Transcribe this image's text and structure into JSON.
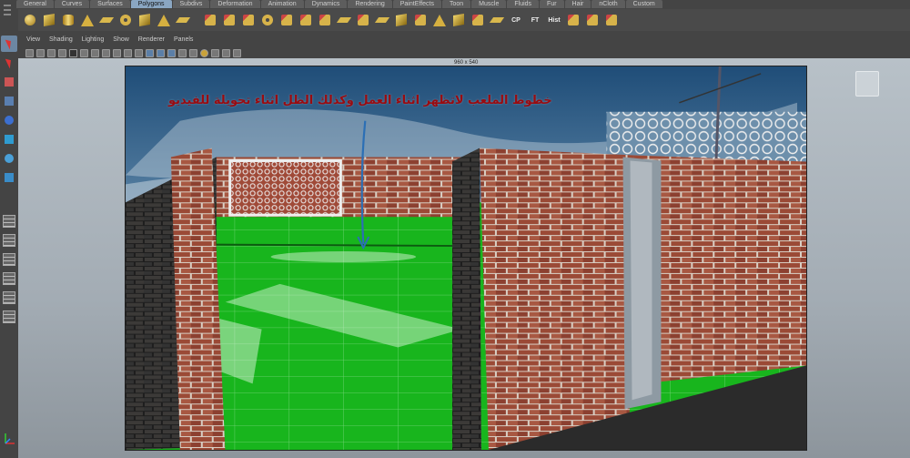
{
  "shelf": {
    "tabs": [
      "General",
      "Curves",
      "Surfaces",
      "Polygons",
      "Subdivs",
      "Deformation",
      "Animation",
      "Dynamics",
      "Rendering",
      "PaintEffects",
      "Toon",
      "Muscle",
      "Fluids",
      "Fur",
      "Hair",
      "nCloth",
      "Custom"
    ],
    "active_tab": "Polygons",
    "icon_labels": [
      "CP",
      "FT",
      "Hist"
    ]
  },
  "panel": {
    "menus": [
      "View",
      "Shading",
      "Lighting",
      "Show",
      "Renderer",
      "Panels"
    ]
  },
  "viewport": {
    "resolution": "960 x 540",
    "caption": "خطوط الملعب لاتظهر اثناء العمل وكذلك الظل اثناء تحويلة للفيديو"
  },
  "colors": {
    "ui_bg": "#444444",
    "active_tab": "#8aa6c2",
    "grass": "#17b51c",
    "brick": "#9b4a36",
    "caption": "#9a0b10"
  }
}
